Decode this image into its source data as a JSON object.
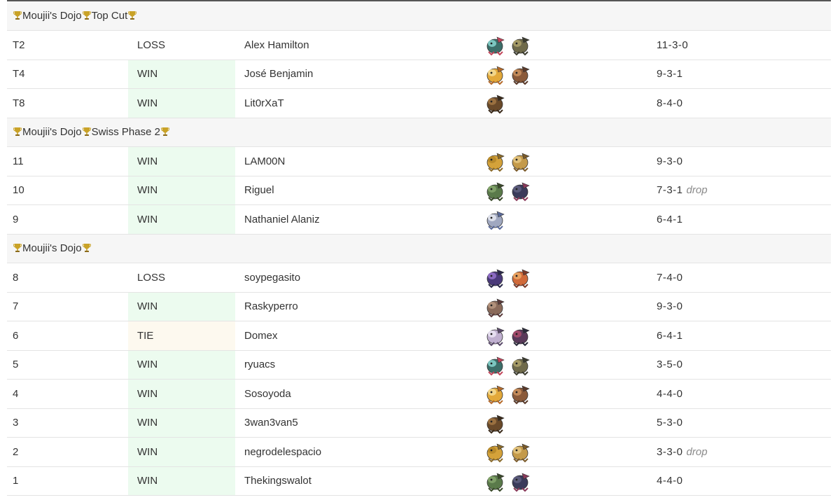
{
  "sections": [
    {
      "title": "Moujii's Dojo🏆Top Cut",
      "title_parts": [
        "Moujii's Dojo",
        "Top Cut"
      ],
      "rows": [
        {
          "round": "T2",
          "result": "LOSS",
          "opponent": "Alex Hamilton",
          "team": [
            "dragapult-icon",
            "archaludon-icon"
          ],
          "record": "11-3-0",
          "drop": ""
        },
        {
          "round": "T4",
          "result": "WIN",
          "opponent": "José Benjamin",
          "team": [
            "dragapult-icon",
            "archaludon-icon"
          ],
          "record": "9-3-1",
          "drop": ""
        },
        {
          "round": "T8",
          "result": "WIN",
          "opponent": "Lit0rXaT",
          "team": [
            "ceruledge-icon"
          ],
          "record": "8-4-0",
          "drop": ""
        }
      ]
    },
    {
      "title": "Moujii's Dojo🏆Swiss Phase 2",
      "title_parts": [
        "Moujii's Dojo",
        "Swiss Phase 2"
      ],
      "rows": [
        {
          "round": "11",
          "result": "WIN",
          "opponent": "LAM00N",
          "team": [
            "terapagos-icon",
            "ursaluna-icon"
          ],
          "record": "9-3-0",
          "drop": ""
        },
        {
          "round": "10",
          "result": "WIN",
          "opponent": "Riguel",
          "team": [
            "pokemon-icon",
            "pokemon-icon"
          ],
          "record": "7-3-1",
          "drop": "drop"
        },
        {
          "round": "9",
          "result": "WIN",
          "opponent": "Nathaniel Alaniz",
          "team": [
            "pokemon-icon"
          ],
          "record": "6-4-1",
          "drop": ""
        }
      ]
    },
    {
      "title": "Moujii's Dojo",
      "title_parts": [
        "Moujii's Dojo"
      ],
      "rows": [
        {
          "round": "8",
          "result": "LOSS",
          "opponent": "soypegasito",
          "team": [
            "pokemon-icon",
            "pokemon-icon"
          ],
          "record": "7-4-0",
          "drop": ""
        },
        {
          "round": "7",
          "result": "WIN",
          "opponent": "Raskyperro",
          "team": [
            "pokemon-icon"
          ],
          "record": "9-3-0",
          "drop": ""
        },
        {
          "round": "6",
          "result": "TIE",
          "opponent": "Domex",
          "team": [
            "dragapult-icon",
            "pokemon-icon"
          ],
          "record": "6-4-1",
          "drop": ""
        },
        {
          "round": "5",
          "result": "WIN",
          "opponent": "ryuacs",
          "team": [
            "pokemon-icon",
            "pokemon-icon"
          ],
          "record": "3-5-0",
          "drop": ""
        },
        {
          "round": "4",
          "result": "WIN",
          "opponent": "Sosoyoda",
          "team": [
            "pokemon-icon",
            "pokemon-icon"
          ],
          "record": "4-4-0",
          "drop": ""
        },
        {
          "round": "3",
          "result": "WIN",
          "opponent": "3wan3van5",
          "team": [
            "dragapult-icon"
          ],
          "record": "5-3-0",
          "drop": ""
        },
        {
          "round": "2",
          "result": "WIN",
          "opponent": "negrodelespacio",
          "team": [
            "pokemon-icon",
            "pokemon-icon"
          ],
          "record": "3-3-0",
          "drop": "drop"
        },
        {
          "round": "1",
          "result": "WIN",
          "opponent": "Thekingswalot",
          "team": [
            "dragapult-icon",
            "archaludon-icon"
          ],
          "record": "4-4-0",
          "drop": ""
        }
      ]
    }
  ],
  "colors": {
    "win_bg": "#ecfbef",
    "tie_bg": "#fdf9ef",
    "section_bg": "#f6f6f6",
    "trophy": "#c9a227"
  },
  "sprite_palettes": [
    [
      "#3c6f6a",
      "#7cc6c0",
      "#c2455a"
    ],
    [
      "#6f6a4a",
      "#a59a66",
      "#3b3b2e"
    ],
    [
      "#e3a93a",
      "#f2d68a",
      "#b56a2a"
    ],
    [
      "#8a5a3a",
      "#c28a5a",
      "#5a3a2a"
    ],
    [
      "#6a4a2a",
      "#9a7040",
      "#3a2a1a"
    ],
    [
      "#d4a23a",
      "#b88a2a",
      "#8a6a2a"
    ],
    [
      "#c49a4a",
      "#e0c07a",
      "#7a5a2a"
    ],
    [
      "#5a7a4a",
      "#7fa068",
      "#3a4a2a"
    ],
    [
      "#3a3a5a",
      "#5a5a7a",
      "#8a3a5a"
    ],
    [
      "#a0a8c0",
      "#dde0ea",
      "#5a6a9a"
    ],
    [
      "#4a3a7a",
      "#8a6ac0",
      "#2a2a4a"
    ],
    [
      "#d06a3a",
      "#e8a060",
      "#7a3a2a"
    ],
    [
      "#8a6a5a",
      "#b0907a",
      "#5a3a3a"
    ],
    [
      "#c0b0d0",
      "#e6dff0",
      "#5a4a6a"
    ],
    [
      "#5a3a5a",
      "#a04a6a",
      "#2a2a3a"
    ]
  ]
}
